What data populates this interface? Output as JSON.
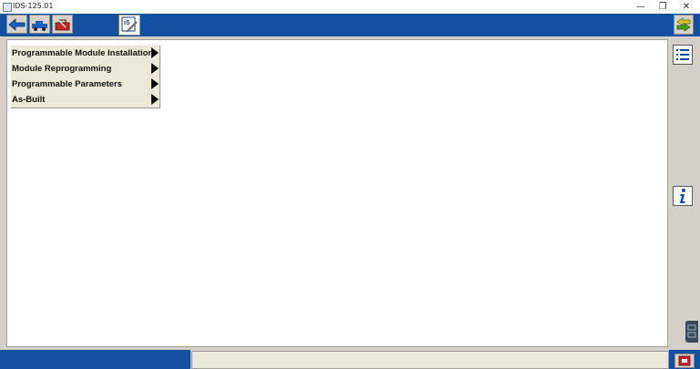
{
  "window": {
    "title": "IDS-125.01",
    "minimize": "—",
    "maximize": "❐",
    "close": "✕"
  },
  "toolbar": {
    "icons": [
      "back-arrow-icon",
      "vehicle-icon",
      "toolbox-icon",
      "ids-logo-icon",
      "exchange-arrows-icon"
    ]
  },
  "menu": {
    "items": [
      {
        "label": "Programmable Module Installation"
      },
      {
        "label": "Module Reprogramming"
      },
      {
        "label": "Programmable Parameters"
      },
      {
        "label": "As-Built"
      }
    ]
  },
  "sidebar": {
    "icons": [
      "list-icon",
      "info-icon"
    ]
  },
  "colors": {
    "toolbar_blue": "#1450a0",
    "menu_bg": "#ece9d8",
    "panel_gray": "#d4d0c8"
  }
}
